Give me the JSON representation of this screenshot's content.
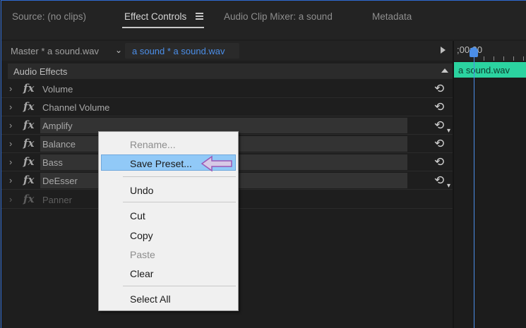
{
  "tabs": [
    {
      "label": "Source: (no clips)"
    },
    {
      "label": "Effect Controls"
    },
    {
      "label": "Audio Clip Mixer: a sound"
    },
    {
      "label": "Metadata"
    }
  ],
  "source_bar": {
    "master": "Master * a sound.wav",
    "clip": "a sound * a sound.wav"
  },
  "section": {
    "title": "Audio Effects"
  },
  "effects": [
    {
      "name": "Volume"
    },
    {
      "name": "Channel Volume"
    },
    {
      "name": "Amplify"
    },
    {
      "name": "Balance"
    },
    {
      "name": "Bass"
    },
    {
      "name": "DeEsser"
    },
    {
      "name": "Panner"
    }
  ],
  "timeline": {
    "time": ";00;00",
    "clip_label": "a sound.wav"
  },
  "context_menu": {
    "items": [
      {
        "label": "Rename..."
      },
      {
        "label": "Save Preset..."
      },
      {
        "label": "Undo"
      },
      {
        "label": "Cut"
      },
      {
        "label": "Copy"
      },
      {
        "label": "Paste"
      },
      {
        "label": "Clear"
      },
      {
        "label": "Select All"
      }
    ]
  },
  "icons": {
    "fx": "fx",
    "chevron": "chevron-right-icon",
    "reset": "reset-icon",
    "menu": "hamburger-icon",
    "arrow": "left-arrow-annotation"
  },
  "colors": {
    "accent_blue": "#4b8ee8",
    "clip_green": "#2bd3a0",
    "menu_highlight": "#91c9f7",
    "annotation_arrow": "#9b59b6"
  }
}
